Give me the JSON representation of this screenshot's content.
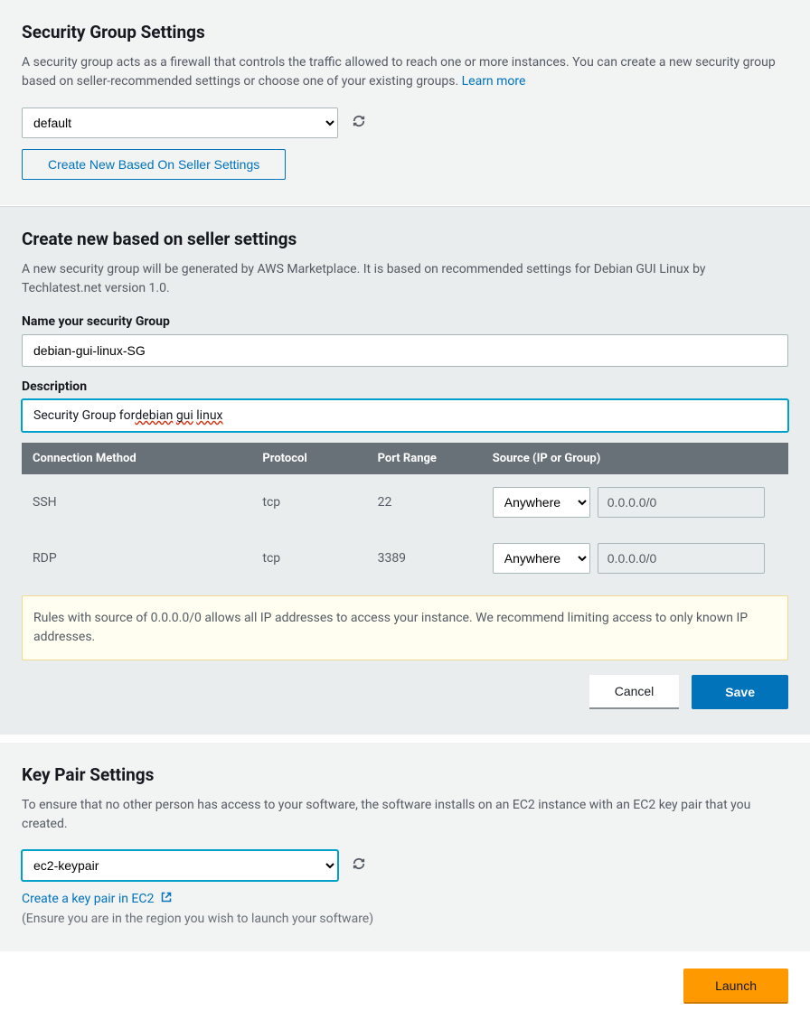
{
  "security_group_settings": {
    "title": "Security Group Settings",
    "description": "A security group acts as a firewall that controls the traffic allowed to reach one or more instances. You can create a new security group based on seller-recommended settings or choose one of your existing groups. ",
    "learn_more": "Learn more",
    "select_value": "default",
    "create_btn": "Create New Based On Seller Settings"
  },
  "create_sg": {
    "title": "Create new based on seller settings",
    "description": "A new security group will be generated by AWS Marketplace. It is based on recommended settings for Debian GUI Linux by Techlatest.net version 1.0.",
    "name_label": "Name your security Group",
    "name_value": "debian-gui-linux-SG",
    "desc_label": "Description",
    "desc_value_prefix": "Security Group for ",
    "desc_value_w1": "debian",
    "desc_value_w2": "gui",
    "desc_value_w3": "linux",
    "headers": {
      "conn": "Connection Method",
      "proto": "Protocol",
      "port": "Port Range",
      "source": "Source (IP or Group)"
    },
    "rows": [
      {
        "conn": "SSH",
        "proto": "tcp",
        "port": "22",
        "src_mode": "Anywhere",
        "src_val": "0.0.0.0/0"
      },
      {
        "conn": "RDP",
        "proto": "tcp",
        "port": "3389",
        "src_mode": "Anywhere",
        "src_val": "0.0.0.0/0"
      }
    ],
    "warning": "Rules with source of 0.0.0.0/0 allows all IP addresses to access your instance. We recommend limiting access to only known IP addresses.",
    "cancel_btn": "Cancel",
    "save_btn": "Save"
  },
  "key_pair": {
    "title": "Key Pair Settings",
    "description": "To ensure that no other person has access to your software, the software installs on an EC2 instance with an EC2 key pair that you created.",
    "select_value": "ec2-keypair",
    "create_link": "Create a key pair in EC2 ",
    "region_note": "(Ensure you are in the region you wish to launch your software)"
  },
  "launch_btn": "Launch"
}
